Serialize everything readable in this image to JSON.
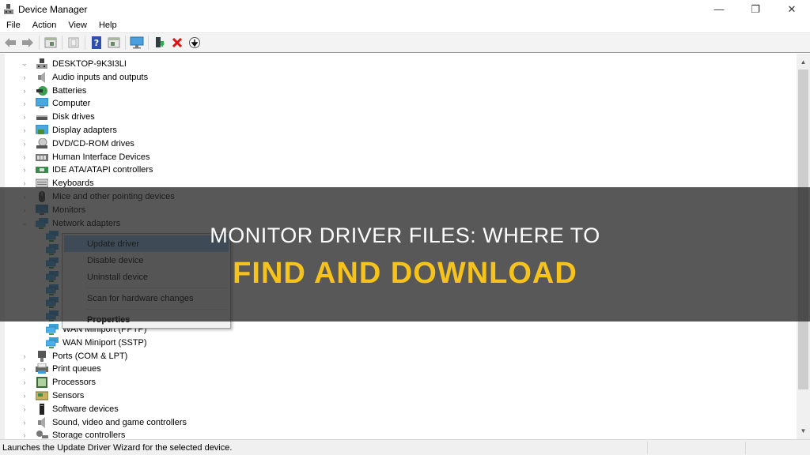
{
  "window": {
    "title": "Device Manager",
    "controls": {
      "minimize": "—",
      "restore": "❐",
      "close": "✕"
    }
  },
  "menubar": {
    "items": [
      "File",
      "Action",
      "View",
      "Help"
    ]
  },
  "toolbar": {
    "buttons": [
      {
        "name": "back",
        "icon": "arrow-left-icon"
      },
      {
        "name": "forward",
        "icon": "arrow-right-icon"
      },
      {
        "name": "show-hide-console-tree",
        "icon": "console-tree-icon"
      },
      {
        "name": "properties",
        "icon": "properties-icon"
      },
      {
        "name": "help",
        "icon": "help-icon"
      },
      {
        "name": "show-action-pane",
        "icon": "action-pane-icon"
      },
      {
        "name": "scan-hardware",
        "icon": "monitor-scan-icon"
      },
      {
        "name": "update-driver",
        "icon": "update-driver-icon"
      },
      {
        "name": "uninstall-device",
        "icon": "red-x-icon"
      },
      {
        "name": "disable-device",
        "icon": "down-arrow-circle-icon"
      }
    ]
  },
  "tree": {
    "root": "DESKTOP-9K3I3LI",
    "categories": [
      {
        "label": "Audio inputs and outputs",
        "icon": "speaker-icon",
        "expanded": false
      },
      {
        "label": "Batteries",
        "icon": "battery-icon",
        "expanded": false
      },
      {
        "label": "Computer",
        "icon": "computer-icon",
        "expanded": false
      },
      {
        "label": "Disk drives",
        "icon": "disk-drive-icon",
        "expanded": false
      },
      {
        "label": "Display adapters",
        "icon": "display-adapter-icon",
        "expanded": false
      },
      {
        "label": "DVD/CD-ROM drives",
        "icon": "dvd-icon",
        "expanded": false
      },
      {
        "label": "Human Interface Devices",
        "icon": "hid-icon",
        "expanded": false
      },
      {
        "label": "IDE ATA/ATAPI controllers",
        "icon": "ide-controller-icon",
        "expanded": false
      },
      {
        "label": "Keyboards",
        "icon": "keyboard-icon",
        "expanded": false
      },
      {
        "label": "Mice and other pointing devices",
        "icon": "mouse-icon",
        "expanded": false
      },
      {
        "label": "Monitors",
        "icon": "monitor-icon",
        "expanded": false
      },
      {
        "label": "Network adapters",
        "icon": "network-adapter-icon",
        "expanded": true
      }
    ],
    "network_children": [
      {
        "label": "",
        "icon": "network-adapter-icon"
      },
      {
        "label": "",
        "icon": "network-adapter-icon"
      },
      {
        "label": "",
        "icon": "network-adapter-icon"
      },
      {
        "label": "",
        "icon": "network-adapter-icon"
      },
      {
        "label": "",
        "icon": "network-adapter-icon"
      },
      {
        "label": "",
        "icon": "network-adapter-icon"
      },
      {
        "label": "",
        "icon": "network-adapter-icon"
      },
      {
        "label": "WAN Miniport (PPTP)",
        "icon": "network-adapter-icon"
      },
      {
        "label": "WAN Miniport (SSTP)",
        "icon": "network-adapter-icon"
      }
    ],
    "categories_after": [
      {
        "label": "Ports (COM & LPT)",
        "icon": "port-icon",
        "expanded": false
      },
      {
        "label": "Print queues",
        "icon": "printer-icon",
        "expanded": false
      },
      {
        "label": "Processors",
        "icon": "processor-icon",
        "expanded": false
      },
      {
        "label": "Sensors",
        "icon": "sensor-icon",
        "expanded": false
      },
      {
        "label": "Software devices",
        "icon": "software-device-icon",
        "expanded": false
      },
      {
        "label": "Sound, video and game controllers",
        "icon": "speaker-icon",
        "expanded": false
      },
      {
        "label": "Storage controllers",
        "icon": "storage-controller-icon",
        "expanded": false
      }
    ]
  },
  "context_menu": {
    "items": [
      {
        "label": "Update driver",
        "highlighted": true,
        "bold": false
      },
      {
        "label": "Disable device",
        "highlighted": false,
        "bold": false
      },
      {
        "label": "Uninstall device",
        "highlighted": false,
        "bold": false
      },
      {
        "label": "Scan for hardware changes",
        "highlighted": false,
        "bold": false
      },
      {
        "label": "Properties",
        "highlighted": false,
        "bold": true
      }
    ]
  },
  "statusbar": {
    "text": "Launches the Update Driver Wizard for the selected device."
  },
  "overlay": {
    "headline_line1": "MONITOR DRIVER FILES: WHERE TO",
    "headline_line2": "FIND AND DOWNLOAD",
    "line1_color": "#ffffff",
    "line2_color": "#f6c31c"
  }
}
